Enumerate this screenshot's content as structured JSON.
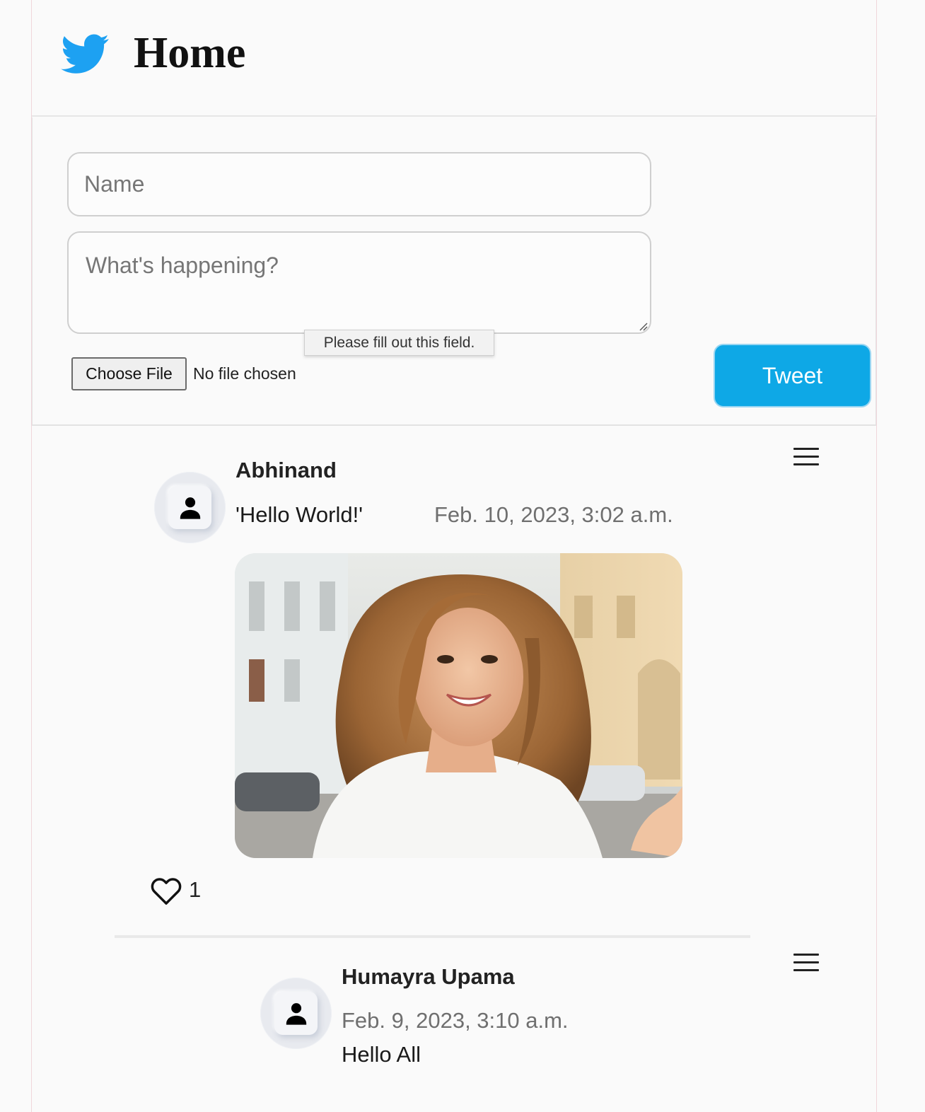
{
  "header": {
    "logo_icon": "twitter-bird-icon",
    "title": "Home",
    "brand_color": "#1da1f2"
  },
  "composer": {
    "name_placeholder": "Name",
    "text_placeholder": "What's happening?",
    "validation_tooltip": "Please fill out this field.",
    "choose_file_label": "Choose File",
    "file_status": "No file chosen",
    "tweet_button_label": "Tweet",
    "tweet_button_color": "#0ea8e6"
  },
  "posts": [
    {
      "author": "Abhinand",
      "text": "'Hello World!'",
      "date": "Feb. 10, 2023, 3:02 a.m.",
      "has_image": true,
      "likes": "1"
    },
    {
      "author": "Humayra Upama",
      "date": "Feb. 9, 2023, 3:10 a.m.",
      "text": "Hello All"
    }
  ]
}
